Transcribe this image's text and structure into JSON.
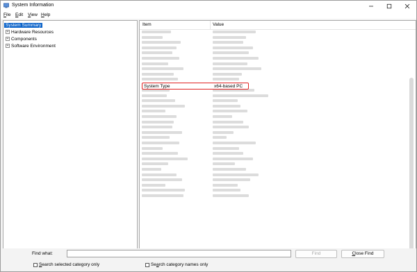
{
  "window": {
    "title": "System Information"
  },
  "menu": [
    {
      "label": "File",
      "key": "F",
      "rest": "ile"
    },
    {
      "label": "Edit",
      "key": "E",
      "rest": "dit"
    },
    {
      "label": "View",
      "key": "V",
      "rest": "iew"
    },
    {
      "label": "Help",
      "key": "H",
      "rest": "elp"
    }
  ],
  "tree": {
    "selected": "System Summary",
    "children": [
      "Hardware Resources",
      "Components",
      "Software Environment"
    ],
    "expander": "+"
  },
  "list": {
    "columns": [
      "Item",
      "Value"
    ],
    "highlighted_row": {
      "item": "System Type",
      "value": "x64-based PC"
    }
  },
  "find": {
    "label": "Find what:",
    "value": "",
    "find_button": "Find",
    "close_button": "Close Find",
    "close_key": "C",
    "close_rest": "lose Find",
    "check_selected": "Search selected category only",
    "check_selected_key": "S",
    "check_selected_rest": "earch selected category only",
    "check_names": "Search category names only",
    "check_names_pre": "Se",
    "check_names_key": "a",
    "check_names_rest": "rch category names only"
  },
  "icons": {
    "minimize": "minimize-icon",
    "maximize": "maximize-icon",
    "close": "close-icon",
    "app": "system-information-icon"
  },
  "colors": {
    "selection": "#0a62c9",
    "highlight_border": "#e02020"
  }
}
